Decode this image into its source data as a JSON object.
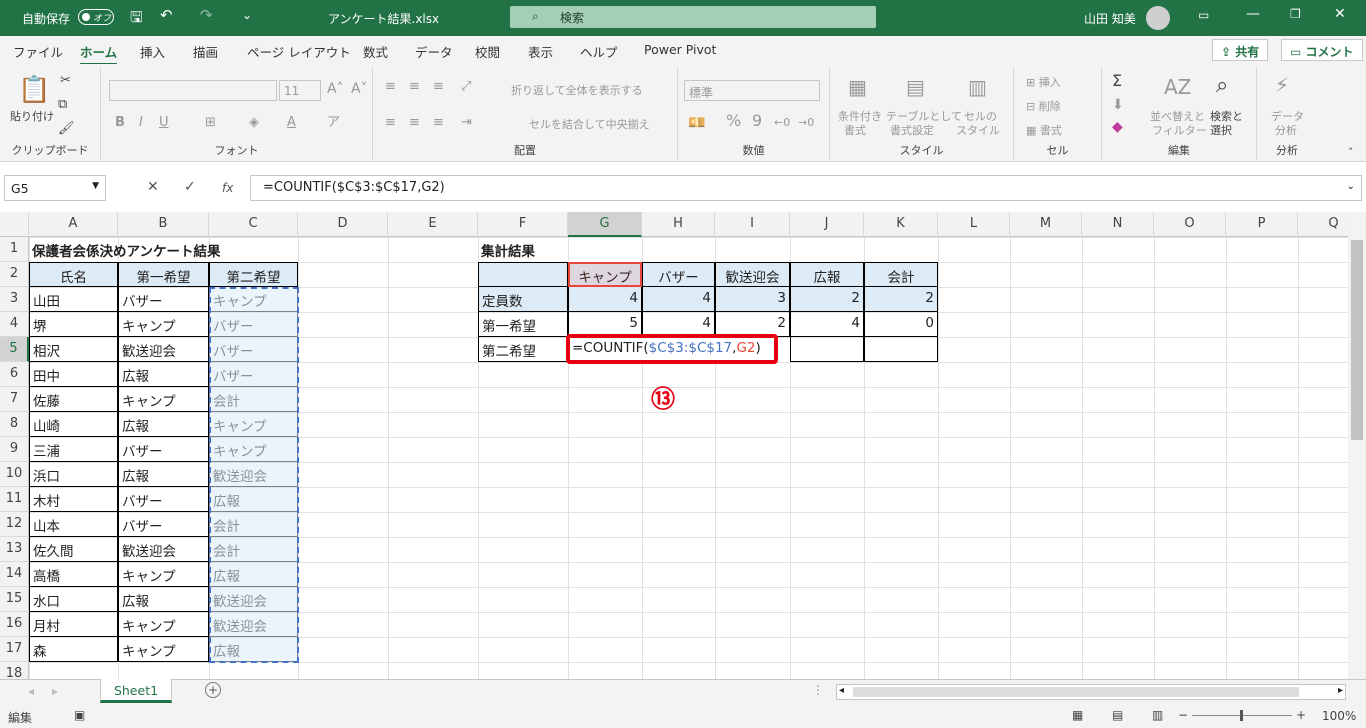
{
  "titlebar": {
    "autosave_label": "自動保存",
    "autosave_state": "オフ",
    "filename": "アンケート結果.xlsx",
    "search_placeholder": "検索",
    "user_name": "山田 知美"
  },
  "menu": {
    "items": [
      "ファイル",
      "ホーム",
      "挿入",
      "描画",
      "ページ レイアウト",
      "数式",
      "データ",
      "校閲",
      "表示",
      "ヘルプ",
      "Power Pivot"
    ],
    "active": "ホーム",
    "share": "共有",
    "comment": "コメント"
  },
  "ribbon": {
    "paste": "貼り付け",
    "clipboard": "クリップボード",
    "font_size": "11",
    "font": "フォント",
    "wrap_text": "折り返して全体を表示する",
    "merge_center": "セルを結合して中央揃え",
    "alignment": "配置",
    "number_format": "標準",
    "number": "数値",
    "cond_format1": "条件付き",
    "cond_format2": "書式",
    "table_format1": "テーブルとして",
    "table_format2": "書式設定",
    "cell_style1": "セルの",
    "cell_style2": "スタイル",
    "styles": "スタイル",
    "insert": "挿入",
    "delete": "削除",
    "format": "書式",
    "cells": "セル",
    "sort_filter1": "並べ替えと",
    "sort_filter2": "フィルター",
    "find_select1": "検索と",
    "find_select2": "選択",
    "editing": "編集",
    "analyze1": "データ",
    "analyze2": "分析",
    "analysis": "分析"
  },
  "formula_bar": {
    "name_box": "G5",
    "formula": "=COUNTIF($C$3:$C$17,G2)"
  },
  "columns": [
    "A",
    "B",
    "C",
    "D",
    "E",
    "F",
    "G",
    "H",
    "I",
    "J",
    "K",
    "L",
    "M",
    "N",
    "O",
    "P",
    "Q"
  ],
  "rows": [
    "1",
    "2",
    "3",
    "4",
    "5",
    "6",
    "7",
    "8",
    "9",
    "10",
    "11",
    "12",
    "13",
    "14",
    "15",
    "16",
    "17",
    "18"
  ],
  "sheet": {
    "title": "保護者会係決めアンケート結果",
    "headers": [
      "氏名",
      "第一希望",
      "第二希望"
    ],
    "records": [
      [
        "山田",
        "バザー",
        "キャンプ"
      ],
      [
        "堺",
        "キャンプ",
        "バザー"
      ],
      [
        "相沢",
        "歓送迎会",
        "バザー"
      ],
      [
        "田中",
        "広報",
        "バザー"
      ],
      [
        "佐藤",
        "キャンプ",
        "会計"
      ],
      [
        "山崎",
        "広報",
        "キャンプ"
      ],
      [
        "三浦",
        "バザー",
        "キャンプ"
      ],
      [
        "浜口",
        "広報",
        "歓送迎会"
      ],
      [
        "木村",
        "バザー",
        "広報"
      ],
      [
        "山本",
        "バザー",
        "会計"
      ],
      [
        "佐久間",
        "歓送迎会",
        "会計"
      ],
      [
        "高橋",
        "キャンプ",
        "広報"
      ],
      [
        "水口",
        "広報",
        "歓送迎会"
      ],
      [
        "月村",
        "キャンプ",
        "歓送迎会"
      ],
      [
        "森",
        "キャンプ",
        "広報"
      ]
    ],
    "summary_title": "集計結果",
    "summary_headers": [
      "キャンプ",
      "バザー",
      "歓送迎会",
      "広報",
      "会計"
    ],
    "summary_rows": [
      {
        "label": "定員数",
        "values": [
          "4",
          "4",
          "3",
          "2",
          "2"
        ]
      },
      {
        "label": "第一希望",
        "values": [
          "5",
          "4",
          "2",
          "4",
          "0"
        ]
      },
      {
        "label": "第二希望",
        "values": [
          "",
          "",
          "",
          "",
          ""
        ]
      }
    ],
    "editing_formula": {
      "prefix": "=COUNTIF(",
      "range": "$C$3:$C$17",
      "comma": ",",
      "ref": "G2",
      "suffix": ")"
    },
    "annotation": "⑬"
  },
  "sheet_tab": "Sheet1",
  "status": {
    "mode": "編集",
    "zoom": "100%"
  },
  "colors": {
    "accent": "#217346",
    "header_fill": "#ddebf7",
    "highlight": "#e60012",
    "range_blue": "#4472c4"
  }
}
